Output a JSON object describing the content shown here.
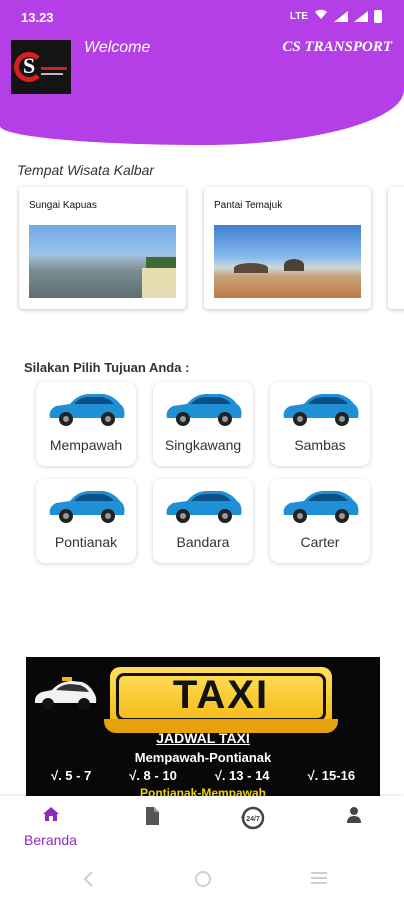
{
  "status_bar": {
    "time": "13.23",
    "network": "LTE"
  },
  "header": {
    "welcome": "Welcome",
    "brand": "CS TRANSPORT"
  },
  "places": {
    "title": "Tempat Wisata Kalbar",
    "items": [
      {
        "name": "Sungai Kapuas"
      },
      {
        "name": "Pantai Temajuk"
      }
    ]
  },
  "destinations": {
    "title": "Silakan Pilih Tujuan Anda :",
    "items": [
      {
        "label": "Mempawah"
      },
      {
        "label": "Singkawang"
      },
      {
        "label": "Sambas"
      },
      {
        "label": "Pontianak"
      },
      {
        "label": "Bandara"
      },
      {
        "label": "Carter"
      }
    ]
  },
  "banner": {
    "sign": "TAXI",
    "title": "JADWAL TAXI",
    "route_1": "Mempawah-Pontianak",
    "times": [
      "√. 5 - 7",
      "√. 8 - 10",
      "√. 13 - 14",
      "√. 15-16"
    ],
    "route_2": "Pontianak-Mempawah"
  },
  "bottom_nav": {
    "items": [
      {
        "label": "Beranda",
        "icon": "home-icon",
        "active": true
      },
      {
        "label": "",
        "icon": "document-icon",
        "active": false
      },
      {
        "label": "",
        "icon": "support-24-icon",
        "badge": "24/7",
        "active": false
      },
      {
        "label": "",
        "icon": "person-icon",
        "active": false
      }
    ]
  },
  "colors": {
    "primary": "#b43fe6",
    "accent": "#8e2bbd",
    "car": "#1f8fd6"
  }
}
